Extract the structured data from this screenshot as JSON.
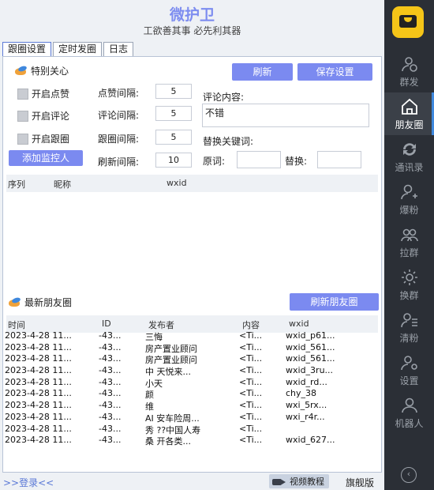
{
  "header": {
    "title": "微护卫",
    "subtitle": "工欲善其事  必先利其器"
  },
  "tabs": [
    "跟圈设置",
    "定时发圈",
    "日志"
  ],
  "special": {
    "heading": "特别关心",
    "refresh_label": "刷新",
    "save_label": "保存设置",
    "checkboxes": [
      "开启点赞",
      "开启评论",
      "开启跟圈"
    ],
    "add_label": "添加监控人",
    "like_interval_label": "点赞间隔:",
    "like_interval": "5",
    "comment_interval_label": "评论间隔:",
    "comment_interval": "5",
    "follow_interval_label": "跟圈间隔:",
    "follow_interval": "5",
    "refresh_interval_label": "刷新间隔:",
    "refresh_interval": "10",
    "comment_content_label": "评论内容:",
    "comment_content": "不错",
    "replace_keyword_label": "替换关键词:",
    "original_label": "原词:",
    "replace_label": "替换:",
    "columns": [
      "序列",
      "昵称",
      "wxid"
    ]
  },
  "latest": {
    "heading": "最新朋友圈",
    "refresh_label": "刷新朋友圈",
    "columns": [
      "时间",
      "ID",
      "发布者",
      "内容",
      "wxid"
    ],
    "rows": [
      [
        "2023-4-28 11...",
        "-43...",
        "三悔",
        "<Ti...",
        "wxid_p61..."
      ],
      [
        "2023-4-28 11...",
        "-43...",
        "房产置业顾问",
        "<Ti...",
        "wxid_561..."
      ],
      [
        "2023-4-28 11...",
        "-43...",
        "房产置业顾问",
        "<Ti...",
        "wxid_561..."
      ],
      [
        "2023-4-28 11...",
        "-43...",
        "中 天悦来...",
        "<Ti...",
        "wxid_3ru..."
      ],
      [
        "2023-4-28 11...",
        "-43...",
        "小天",
        "<Ti...",
        "wxid_rd..."
      ],
      [
        "2023-4-28 11...",
        "-43...",
        "颜",
        "<Ti...",
        "chy_38"
      ],
      [
        "2023-4-28 11...",
        "-43...",
        "维",
        "<Ti...",
        "wxi_5rx..."
      ],
      [
        "2023-4-28 11...",
        "-43...",
        "AI 安车险周...",
        "<Ti...",
        "wxi_r4r..."
      ],
      [
        "2023-4-28 11...",
        "-43...",
        "秀 ??中国人寿",
        "<Ti...",
        ""
      ],
      [
        "2023-4-28 11...",
        "-43...",
        "桑 开各类...",
        "<Ti...",
        "wxid_627..."
      ]
    ]
  },
  "bottom": {
    "login": ">>登录<<",
    "video": "视频教程",
    "version": "旗舰版"
  },
  "sidebar": {
    "items": [
      {
        "label": "群发",
        "icon": "user-send-icon"
      },
      {
        "label": "朋友圈",
        "icon": "home-icon"
      },
      {
        "label": "通讯录",
        "icon": "sync-icon"
      },
      {
        "label": "爆粉",
        "icon": "add-user-icon"
      },
      {
        "label": "拉群",
        "icon": "group-icon"
      },
      {
        "label": "换群",
        "icon": "sun-icon"
      },
      {
        "label": "清粉",
        "icon": "user-list-icon"
      },
      {
        "label": "设置",
        "icon": "user-gear-icon"
      },
      {
        "label": "机器人",
        "icon": "robot-user-icon"
      }
    ]
  },
  "colors": {
    "accent": "#7b8af0",
    "sidebar": "#2b2f36",
    "logo": "#f5c518"
  }
}
